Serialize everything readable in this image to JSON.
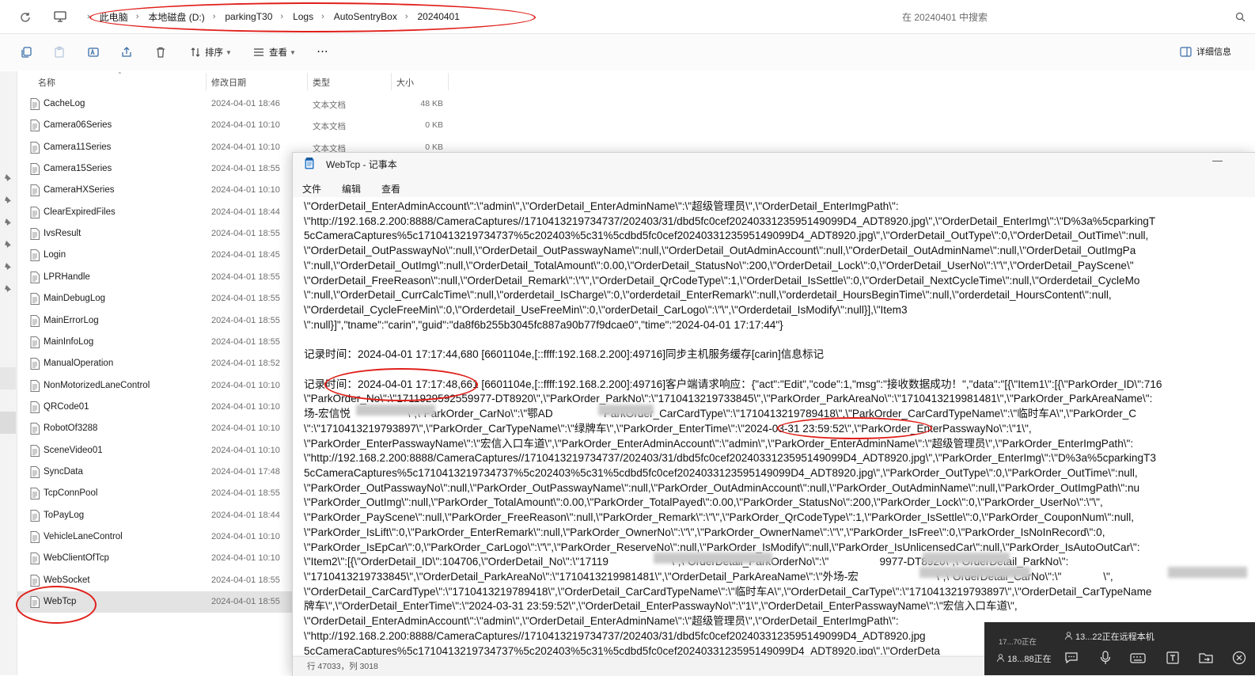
{
  "addressbar": {
    "breadcrumb": [
      "此电脑",
      "本地磁盘 (D:)",
      "parkingT30",
      "Logs",
      "AutoSentryBox",
      "20240401"
    ],
    "search_placeholder": "在 20240401 中搜索"
  },
  "commandbar": {
    "sort_label": "排序",
    "view_label": "查看",
    "more_label": "···",
    "details_label": "详细信息"
  },
  "filelist": {
    "headers": {
      "name": "名称",
      "date": "修改日期",
      "type": "类型",
      "size": "大小"
    },
    "rows": [
      {
        "name": "CacheLog",
        "date": "2024-04-01 18:46",
        "type": "文本文档",
        "size": "48 KB"
      },
      {
        "name": "Camera06Series",
        "date": "2024-04-01 10:10",
        "type": "文本文档",
        "size": "0 KB"
      },
      {
        "name": "Camera11Series",
        "date": "2024-04-01 10:10",
        "type": "文本文档",
        "size": "0 KB"
      },
      {
        "name": "Camera15Series",
        "date": "2024-04-01 18:55",
        "type": "",
        "size": ""
      },
      {
        "name": "CameraHXSeries",
        "date": "2024-04-01 10:10",
        "type": "",
        "size": ""
      },
      {
        "name": "ClearExpiredFiles",
        "date": "2024-04-01 18:44",
        "type": "",
        "size": ""
      },
      {
        "name": "IvsResult",
        "date": "2024-04-01 18:55",
        "type": "",
        "size": ""
      },
      {
        "name": "Login",
        "date": "2024-04-01 18:45",
        "type": "",
        "size": ""
      },
      {
        "name": "LPRHandle",
        "date": "2024-04-01 18:55",
        "type": "",
        "size": ""
      },
      {
        "name": "MainDebugLog",
        "date": "2024-04-01 18:55",
        "type": "",
        "size": ""
      },
      {
        "name": "MainErrorLog",
        "date": "2024-04-01 18:55",
        "type": "",
        "size": ""
      },
      {
        "name": "MainInfoLog",
        "date": "2024-04-01 18:55",
        "type": "",
        "size": ""
      },
      {
        "name": "ManualOperation",
        "date": "2024-04-01 18:52",
        "type": "",
        "size": ""
      },
      {
        "name": "NonMotorizedLaneControl",
        "date": "2024-04-01 10:10",
        "type": "",
        "size": ""
      },
      {
        "name": "QRCode01",
        "date": "2024-04-01 10:10",
        "type": "",
        "size": ""
      },
      {
        "name": "RobotOf3288",
        "date": "2024-04-01 10:10",
        "type": "",
        "size": ""
      },
      {
        "name": "SceneVideo01",
        "date": "2024-04-01 10:10",
        "type": "",
        "size": ""
      },
      {
        "name": "SyncData",
        "date": "2024-04-01 17:48",
        "type": "",
        "size": ""
      },
      {
        "name": "TcpConnPool",
        "date": "2024-04-01 18:55",
        "type": "",
        "size": ""
      },
      {
        "name": "ToPayLog",
        "date": "2024-04-01 18:44",
        "type": "",
        "size": ""
      },
      {
        "name": "VehicleLaneControl",
        "date": "2024-04-01 10:10",
        "type": "",
        "size": ""
      },
      {
        "name": "WebClientOfTcp",
        "date": "2024-04-01 10:10",
        "type": "",
        "size": ""
      },
      {
        "name": "WebSocket",
        "date": "2024-04-01 18:55",
        "type": "",
        "size": ""
      },
      {
        "name": "WebTcp",
        "date": "2024-04-01 18:55",
        "type": "",
        "size": ""
      }
    ]
  },
  "notepad": {
    "title": "WebTcp - 记事本",
    "minimize_glyph": "—",
    "menu": [
      "文件",
      "编辑",
      "查看"
    ],
    "lines": [
      "\\\"OrderDetail_EnterAdminAccount\\\":\\\"admin\\\",\\\"OrderDetail_EnterAdminName\\\":\\\"超级管理员\\\",\\\"OrderDetail_EnterImgPath\\\":",
      "\\\"http://192.168.2.200:8888/CameraCaptures//1710413219734737/202403/31/dbd5fc0cef20240331235951​49099D4_ADT8920.jpg\\\",\\\"OrderDetail_EnterImg\\\":\\\"D%3a%5cparkingT",
      "5cCameraCaptures%5c1710413219734737%5c202403%5c31%5cdbd5fc0cef20240331235951​49099D4_ADT8920.jpg\\\",\\\"OrderDetail_OutType\\\":0,\\\"OrderDetail_OutTime\\\":null,",
      "\\\"OrderDetail_OutPasswayNo\\\":null,\\\"OrderDetail_OutPasswayName\\\":null,\\\"OrderDetail_OutAdminAccount\\\":null,\\\"OrderDetail_OutAdminName\\\":null,\\\"OrderDetail_OutImgPa",
      "\\\":null,\\\"OrderDetail_OutImg\\\":null,\\\"OrderDetail_TotalAmount\\\":0.00,\\\"OrderDetail_StatusNo\\\":200,\\\"OrderDetail_Lock\\\":0,\\\"OrderDetail_UserNo\\\":\\\"\\\",\\\"OrderDetail_PayScene\\\"",
      "\\\"OrderDetail_FreeReason\\\":null,\\\"OrderDetail_Remark\\\":\\\"\\\",\\\"OrderDetail_QrCodeType\\\":1,\\\"OrderDetail_IsSettle\\\":0,\\\"OrderDetail_NextCycleTime\\\":null,\\\"Orderdetail_CycleMo",
      "\\\":null,\\\"OrderDetail_CurrCalcTime\\\":null,\\\"orderdetail_IsCharge\\\":0,\\\"orderdetail_EnterRemark\\\":null,\\\"orderdetail_HoursBeginTime\\\":null,\\\"orderdetail_HoursContent\\\":null,",
      "\\\"Orderdetail_CycleFreeMin\\\":0,\\\"Orderdetail_UseFreeMin\\\":0,\\\"orderDetail_CarLogo\\\":\\\"\\\",\\\"Orderdetail_IsModify\\\":null}],\\\"Item3",
      "\\\":null}]\",\"tname\":\"carin\",\"guid\":\"da8f6b255b3045fc887a90b77f9dcae0\",\"time\":\"2024-04-01 17:17:44\"}",
      "",
      "记录时间：2024-04-01 17:17:44,680 [6601104e,[::ffff:192.168.2.200]:49716]同步主机服务缓存[carin]信息标记",
      "",
      "记录时间：2024-04-01 17:17:48,661 [6601104e,[::ffff:192.168.2.200]:49716]客户端请求响应：{\"act\":\"Edit\",\"code\":1,\"msg\":\"接收数据成功！\",\"data\":\"[{\\\"Item1\\\":[{\\\"ParkOrder_ID\\\":716",
      "\\\"ParkOrder_No\\\":\\\"17119295925599​77-DT8920\\\",\\\"ParkOrder_ParkNo\\\":\\\"1710413219733845\\\",\\\"ParkOrder_ParkAreaNo\\\":\\\"1710413219981481\\\",\\\"ParkOrder_ParkAreaName\\\":",
      "场-宏信悦                   \\\",\\\"ParkOrder_CarNo\\\":\\\"鄂AD                 ParkOrder_CarCardType\\\":\\\"1710413219789418\\\",\\\"ParkOrder_CarCardTypeName\\\":\\\"临时车A\\\",\\\"ParkOrder_C",
      "\\\":\\\"1710413219793897\\\",\\\"ParkOrder_CarTypeName\\\":\\\"绿牌车\\\",\\\"ParkOrder_EnterTime\\\":\\\"2024-03-31 23:59:52\\\",\\\"ParkOrder_EnterPasswayNo\\\":\\\"1\\\",",
      "\\\"ParkOrder_EnterPasswayName\\\":\\\"宏信入口车道\\\",\\\"ParkOrder_EnterAdminAccount\\\":\\\"admin\\\",\\\"ParkOrder_EnterAdminName\\\":\\\"超级管理员\\\",\\\"ParkOrder_EnterImgPath\\\":",
      "\\\"http://192.168.2.200:8888/CameraCaptures//1710413219734737/202403/31/dbd5fc0cef20240331235951​49099D4_ADT8920.jpg\\\",\\\"ParkOrder_EnterImg\\\":\\\"D%3a%5cparkingT3",
      "5cCameraCaptures%5c1710413219734737%5c202403%5c31%5cdbd5fc0cef20240331235951​49099D4_ADT8920.jpg\\\",\\\"ParkOrder_OutType\\\":0,\\\"ParkOrder_OutTime\\\":null,",
      "\\\"ParkOrder_OutPasswayNo\\\":null,\\\"ParkOrder_OutPasswayName\\\":null,\\\"ParkOrder_OutAdminAccount\\\":null,\\\"ParkOrder_OutAdminName\\\":null,\\\"ParkOrder_OutImgPath\\\":nu",
      "\\\"ParkOrder_OutImg\\\":null,\\\"ParkOrder_TotalAmount\\\":0.00,\\\"ParkOrder_TotalPayed\\\":0.00,\\\"ParkOrder_StatusNo\\\":200,\\\"ParkOrder_Lock\\\":0,\\\"ParkOrder_UserNo\\\":\\\"\\\",",
      "\\\"ParkOrder_PayScene\\\":null,\\\"ParkOrder_FreeReason\\\":null,\\\"ParkOrder_Remark\\\":\\\"\\\",\\\"ParkOrder_QrCodeType\\\":1,\\\"ParkOrder_IsSettle\\\":0,\\\"ParkOrder_CouponNum\\\":null,",
      "\\\"ParkOrder_IsLift\\\":0,\\\"ParkOrder_EnterRemark\\\":null,\\\"ParkOrder_OwnerNo\\\":\\\"\\\",\\\"ParkOrder_OwnerName\\\":\\\"\\\",\\\"ParkOrder_IsFree\\\":0,\\\"ParkOrder_IsNoInRecord\\\":0,",
      "\\\"ParkOrder_IsEpCar\\\":0,\\\"ParkOrder_CarLogo\\\":\\\"\\\",\\\"ParkOrder_ReserveNo\\\":null,\\\"ParkOrder_IsModify\\\":null,\\\"ParkOrder_IsUnlicensedCar\\\":null,\\\"ParkOrder_IsAutoOutCar\\\":",
      "\\\"Item2\\\":[{\\\"OrderDetail_ID\\\":104706,\\\"OrderDetail_No\\\":\\\"17119                     \\\",\\\"OrderDetail_ParkOrderNo\\\":\\\"                 9977-DT8920\\\",\\\"OrderDetail_ParkNo\\\":",
      "\\\"1710413219733845\\\",\\\"OrderDetail_ParkAreaNo\\\":\\\"1710413219981481\\\",\\\"OrderDetail_ParkAreaName\\\":\\\"外场-宏                          \\\",\\\"OrderDetail_CarNo\\\":\\\"              \\\",",
      "\\\"OrderDetail_CarCardType\\\":\\\"1710413219789418\\\",\\\"OrderDetail_CarCardTypeName\\\":\\\"临时车A\\\",\\\"OrderDetail_CarType\\\":\\\"1710413219793897\\\",\\\"OrderDetail_CarTypeName",
      "牌车\\\",\\\"OrderDetail_EnterTime\\\":\\\"2024-03-31 23:59:52\\\",\\\"OrderDetail_EnterPasswayNo\\\":\\\"1\\\",\\\"OrderDetail_EnterPasswayName\\\":\\\"宏信入口车道\\\",",
      "\\\"OrderDetail_EnterAdminAccount\\\":\\\"admin\\\",\\\"OrderDetail_EnterAdminName\\\":\\\"超级管理员\\\",\\\"OrderDetail_EnterImgPath\\\":",
      "\\\"http://192.168.2.200:8888/CameraCaptures//1710413219734737/202403/31/dbd5fc0cef20240331235951​49099D4_ADT8920.jpg",
      "5cCameraCaptures%5c1710413219734737%5c202403%5c31%5cdbd5fc0cef20240331235951​49099D4_ADT8920.jpg\\\",\\\"OrderDeta"
    ],
    "status": "行 47033，列 3018"
  },
  "remote": {
    "peer1": "13...22正在远程本机",
    "peer2": "18...88正在",
    "peer3": "17...70正在"
  },
  "colors": {
    "annotation_red": "#e0201b",
    "selected_row": "#e3e3e3",
    "accent_blue": "#3a6ea8"
  }
}
